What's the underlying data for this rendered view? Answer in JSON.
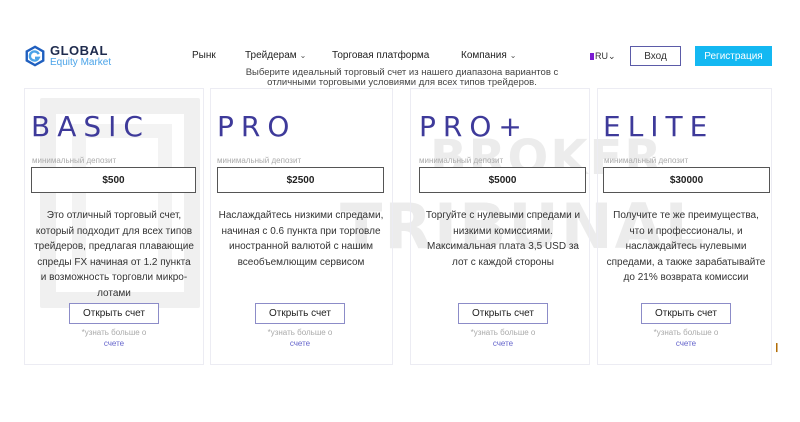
{
  "header": {
    "logo_title": "GLOBAL",
    "logo_subtitle": "Equity Market",
    "nav": [
      "Рынк",
      "Трейдерам",
      "Торговая платформа",
      "Компания"
    ],
    "lang": "RU",
    "login": "Вход",
    "register": "Регистрация"
  },
  "intro": "Выберите идеальный торговый счет из нашего диапазона вариантов с отличными торговыми условиями для всех типов трейдеров.",
  "watermark": {
    "line1": "BROKER",
    "line2": "TRIBUNAL"
  },
  "cards": [
    {
      "title": "BASIC",
      "deposit_label": "минимальный депозит",
      "deposit": "$500",
      "desc": "Это отличный торговый счет, который подходит для всех типов трейдеров, предлагая плавающие спреды FX начиная от 1.2 пункта и возможность торговли микро-лотами",
      "button": "Открыть счет",
      "more": "*узнать больше о",
      "more_link": "счете"
    },
    {
      "title": "PRO",
      "deposit_label": "минимальный депозит",
      "deposit": "$2500",
      "desc": "Наслаждайтесь низкими спредами, начиная с 0.6 пункта при торговле иностранной валютой с нашим всеобъемлющим сервисом",
      "button": "Открыть счет",
      "more": "*узнать больше о",
      "more_link": "счете"
    },
    {
      "title": "PRO+",
      "deposit_label": "минимальный депозит",
      "deposit": "$5000",
      "desc": "Торгуйте с нулевыми спредами и низкими комиссиями. Максимальная плата 3,5 USD за лот с каждой стороны",
      "button": "Открыть счет",
      "more": "*узнать больше о",
      "more_link": "счете"
    },
    {
      "title": "ELITE",
      "deposit_label": "минимальный депозит",
      "deposit": "$30000",
      "desc": "Получите те же преимущества, что и профессионалы, и наслаждайтесь нулевыми спредами, а также зарабатывайте до 21% возврата комиссии",
      "button": "Открыть счет",
      "more": "*узнать больше о",
      "more_link": "счете"
    }
  ],
  "colors": {
    "accent": "#3e3a9a",
    "register_bg": "#14b8f2",
    "logo_blue": "#4aa3e8"
  }
}
